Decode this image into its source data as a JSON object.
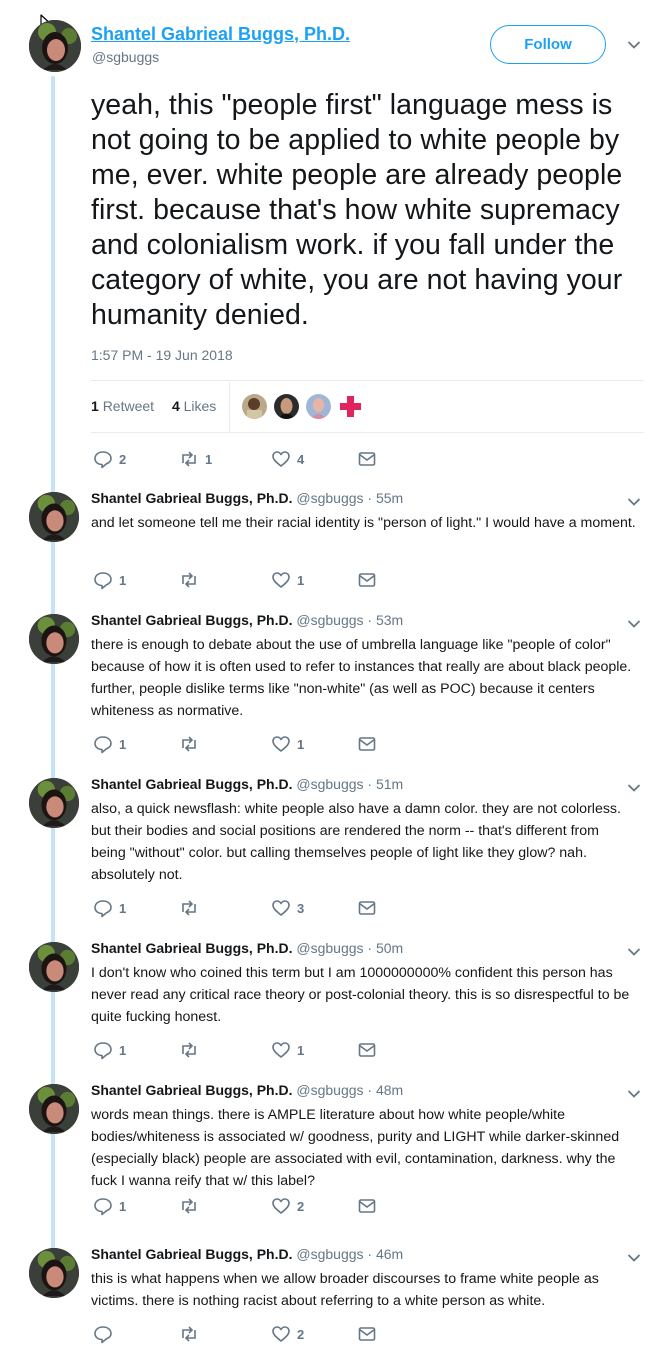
{
  "main_tweet": {
    "display_name": "Shantel Gabrieal Buggs, Ph.D.",
    "handle": "@sgbuggs",
    "follow_label": "Follow",
    "text": "yeah, this \"people first\" language mess is not going to be applied to white people by me, ever. white people are already people first. because that's how white supremacy and colonialism work. if you fall under the category of white, you are not having your humanity denied.",
    "timestamp": "1:57 PM - 19 Jun 2018",
    "retweet_count": "1",
    "retweet_label": "Retweet",
    "like_count": "4",
    "like_label": "Likes",
    "actions": {
      "replies": "2",
      "retweets": "1",
      "likes": "4"
    }
  },
  "replies": [
    {
      "name": "Shantel Gabrieal Buggs, Ph.D.",
      "meta": "@sgbuggs · 55m",
      "text": "and let someone tell me their racial identity is \"person of light.\" I would have a moment.",
      "replies": "1",
      "retweets": "",
      "likes": "1"
    },
    {
      "name": "Shantel Gabrieal Buggs, Ph.D.",
      "meta": "@sgbuggs · 53m",
      "text": "there is enough to debate about the use of umbrella language like \"people of color\" because of how it is often used to refer to instances that really are about black people. further, people dislike terms like \"non-white\" (as well as POC) because it centers whiteness as normative.",
      "replies": "1",
      "retweets": "",
      "likes": "1"
    },
    {
      "name": "Shantel Gabrieal Buggs, Ph.D.",
      "meta": "@sgbuggs · 51m",
      "text": "also, a quick newsflash: white people also have a damn color. they are not colorless. but their bodies and social positions are rendered the norm -- that's different from being \"without\" color. but calling themselves people of light like they glow? nah. absolutely not.",
      "replies": "1",
      "retweets": "",
      "likes": "3"
    },
    {
      "name": "Shantel Gabrieal Buggs, Ph.D.",
      "meta": "@sgbuggs · 50m",
      "text": "I don't know who coined this term but I am 1000000000% confident this person has never read any critical race theory or post-colonial theory. this is so disrespectful to be quite fucking honest.",
      "replies": "1",
      "retweets": "",
      "likes": "1"
    },
    {
      "name": "Shantel Gabrieal Buggs, Ph.D.",
      "meta": "@sgbuggs · 48m",
      "text": "words mean things. there is AMPLE literature about how white people/white bodies/whiteness is associated w/ goodness, purity and LIGHT while darker-skinned (especially black) people are associated with evil, contamination, darkness. why the fuck I wanna reify that w/ this label?",
      "replies": "1",
      "retweets": "",
      "likes": "2"
    },
    {
      "name": "Shantel Gabrieal Buggs, Ph.D.",
      "meta": "@sgbuggs · 46m",
      "text": "this is what happens when we allow broader discourses to frame white people as victims. there is nothing racist about referring to a white person as white.",
      "replies": "",
      "retweets": "",
      "likes": "2"
    }
  ],
  "icons": [
    "reply-icon",
    "retweet-icon",
    "like-icon",
    "message-icon",
    "chevron-down-icon",
    "cursor-icon"
  ],
  "colors": {
    "accent": "#1da1f2",
    "thread_line": "#c4e2f8",
    "muted": "#657786",
    "text": "#14171a",
    "cross": "#e0245e"
  }
}
